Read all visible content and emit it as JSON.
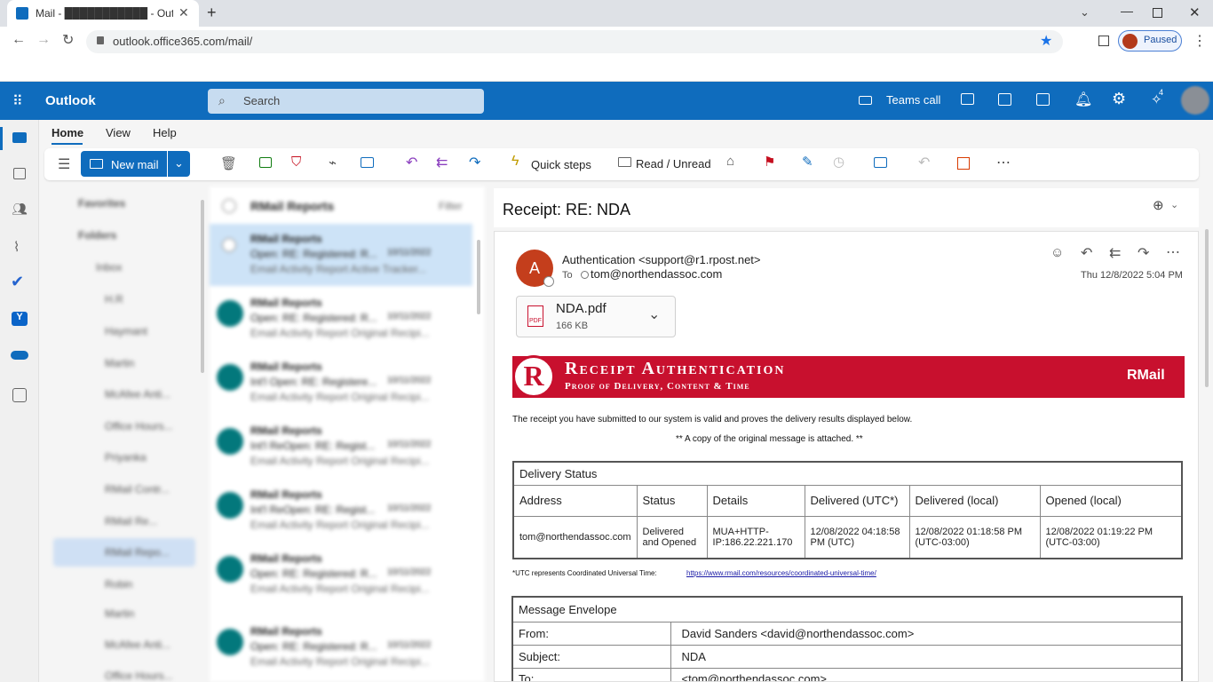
{
  "browser": {
    "tab_title": "Mail - ███████████ - Outlook",
    "url": "outlook.office365.com/mail/",
    "profile_status": "Paused"
  },
  "outlook": {
    "app_name": "Outlook",
    "search_placeholder": "Search",
    "teams_call": "Teams call",
    "notification_count": "4"
  },
  "ribbon": {
    "tabs": [
      "Home",
      "View",
      "Help"
    ],
    "new_mail": "New mail",
    "quick_steps": "Quick steps",
    "read_unread": "Read / Unread"
  },
  "folders": {
    "favorites": "Favorites",
    "folders_header": "Folders",
    "items": [
      "Inbox",
      "H.R",
      "Haymant",
      "Martin",
      "McAfee Anti...",
      "Office Hours...",
      "Priyanka",
      "RMail Contr...",
      "RMail Re...",
      "RMail Repo...",
      "Robin",
      "Martin",
      "McAfee Anti...",
      "Office Hours..."
    ]
  },
  "message_list": {
    "header": "RMail Reports",
    "filter": "Filter",
    "items": [
      {
        "from": "RMail Reports",
        "subject": "Open: RE: Registered: R...",
        "date": "10/11/2022",
        "preview": "Email Activity Report Active Tracker..."
      },
      {
        "from": "RMail Reports",
        "subject": "Open: RE: Registered: R...",
        "date": "10/11/2022",
        "preview": "Email Activity Report Original Recipi..."
      },
      {
        "from": "RMail Reports",
        "subject": "Int'l Open: RE: Registere...",
        "date": "10/11/2022",
        "preview": "Email Activity Report Original Recipi..."
      },
      {
        "from": "RMail Reports",
        "subject": "Int'l ReOpen: RE: Regist...",
        "date": "10/11/2022",
        "preview": "Email Activity Report Original Recipi..."
      },
      {
        "from": "RMail Reports",
        "subject": "Int'l ReOpen: RE: Regist...",
        "date": "10/11/2022",
        "preview": "Email Activity Report Original Recipi..."
      },
      {
        "from": "RMail Reports",
        "subject": "Open: RE: Registered: R...",
        "date": "10/11/2022",
        "preview": "Email Activity Report Original Recipi..."
      },
      {
        "from": "RMail Reports",
        "subject": "Open: RE: Registered: R...",
        "date": "10/11/2022",
        "preview": "Email Activity Report Original Recipi..."
      }
    ]
  },
  "reading": {
    "subject": "Receipt: RE: NDA",
    "avatar_letter": "A",
    "sender": "Authentication <support@r1.rpost.net>",
    "to_label": "To",
    "to": "tom@northendassoc.com",
    "date": "Thu 12/8/2022 5:04 PM",
    "attachment_name": "NDA.pdf",
    "attachment_size": "166 KB",
    "attachment_type": "PDF",
    "banner_title": "Receipt Authentication",
    "banner_subtitle": "Proof of Delivery, Content & Time",
    "banner_brand": "RMail",
    "intro": "The receipt you have submitted to our system is valid and proves the delivery results displayed below.",
    "copy_note": "** A copy of the original message is attached. **",
    "delivery_status": {
      "title": "Delivery Status",
      "headers": [
        "Address",
        "Status",
        "Details",
        "Delivered (UTC*)",
        "Delivered (local)",
        "Opened (local)"
      ],
      "row": [
        "tom@northendassoc.com",
        "Delivered and Opened",
        "MUA+HTTP-IP:186.22.221.170",
        "12/08/2022 04:18:58 PM (UTC)",
        "12/08/2022 01:18:58 PM (UTC-03:00)",
        "12/08/2022 01:19:22 PM (UTC-03:00)"
      ]
    },
    "utc_note": "*UTC represents Coordinated Universal Time:",
    "utc_link": "https://www.rmail.com/resources/coordinated-universal-time/",
    "envelope": {
      "title": "Message Envelope",
      "rows": [
        {
          "label": "From:",
          "value": "David Sanders <david@northendassoc.com>"
        },
        {
          "label": "Subject:",
          "value": "NDA"
        },
        {
          "label": "To:",
          "value": "<tom@northendassoc.com>"
        }
      ]
    }
  },
  "colors": {
    "outlook_blue": "#0f6cbd",
    "banner_red": "#c8102e",
    "avatar_orange": "#c43e1c"
  }
}
